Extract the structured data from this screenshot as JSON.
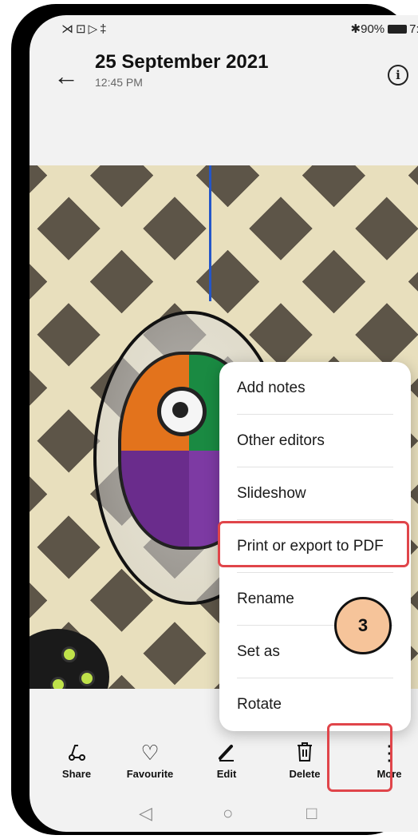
{
  "status_bar": {
    "left_icons": "⋊⊡▷‡",
    "battery": "90%",
    "time": "7:0"
  },
  "header": {
    "title": "25 September 2021",
    "subtitle": "12:45 PM",
    "back_icon": "←",
    "info_icon": "i"
  },
  "menu": {
    "items": [
      {
        "label": "Add notes"
      },
      {
        "label": "Other editors"
      },
      {
        "label": "Slideshow"
      },
      {
        "label": "Print or export to PDF"
      },
      {
        "label": "Rename"
      },
      {
        "label": "Set as"
      },
      {
        "label": "Rotate"
      }
    ],
    "highlighted_item": "Print or export to PDF"
  },
  "step_badge": "3",
  "toolbar": {
    "share": {
      "label": "Share",
      "icon": "share-icon"
    },
    "favourite": {
      "label": "Favourite",
      "icon": "heart-icon"
    },
    "edit": {
      "label": "Edit",
      "icon": "pencil-icon"
    },
    "delete": {
      "label": "Delete",
      "icon": "trash-icon"
    },
    "more": {
      "label": "More",
      "icon": "more-vertical-icon"
    }
  },
  "nav_bar": {
    "back": "◁",
    "home": "○",
    "recents": "□"
  },
  "colors": {
    "highlight": "#e0454a",
    "badge": "#f6c49a"
  }
}
